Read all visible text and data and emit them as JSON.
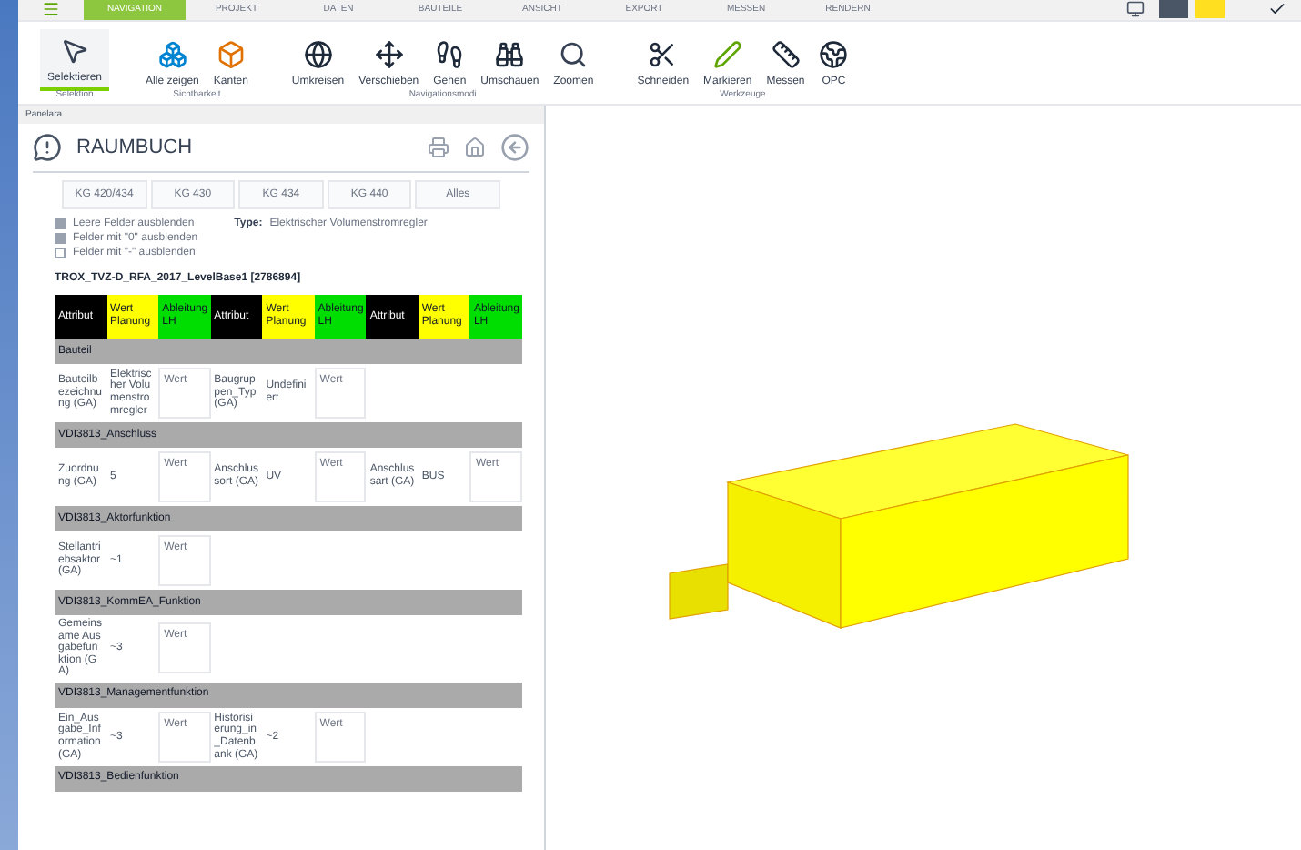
{
  "tabs": [
    {
      "label": "NAVIGATION",
      "selected": true
    },
    {
      "label": "PROJEKT",
      "selected": false
    },
    {
      "label": "DATEN",
      "selected": false
    },
    {
      "label": "BAUTEILE",
      "selected": false
    },
    {
      "label": "ANSICHT",
      "selected": false
    },
    {
      "label": "EXPORT",
      "selected": false
    },
    {
      "label": "MESSEN",
      "selected": false
    },
    {
      "label": "RENDERN",
      "selected": false
    }
  ],
  "ribbon": [
    {
      "label": "Selektion",
      "tools": [
        {
          "kind": "select",
          "label": "Selektieren",
          "selected": true
        }
      ]
    },
    {
      "label": "Sichtbarkeit",
      "tools": [
        {
          "kind": "show",
          "label": "Alle zeigen",
          "selected": false
        },
        {
          "kind": "edges",
          "label": "Kanten",
          "selected": false
        }
      ]
    },
    {
      "label": "Navigationsmodi",
      "tools": [
        {
          "kind": "orbit",
          "label": "Umkreisen",
          "selected": false
        },
        {
          "kind": "move",
          "label": "Verschieben",
          "selected": false
        },
        {
          "kind": "walk",
          "label": "Gehen",
          "selected": false
        },
        {
          "kind": "look",
          "label": "Umschauen",
          "selected": false
        },
        {
          "kind": "zoom",
          "label": "Zoomen",
          "selected": false
        }
      ]
    },
    {
      "label": "Werkzeuge",
      "tools": [
        {
          "kind": "cut",
          "label": "Schneiden",
          "selected": false
        },
        {
          "kind": "mark",
          "label": "Markieren",
          "selected": false
        },
        {
          "kind": "measure",
          "label": "Messen",
          "selected": false
        },
        {
          "kind": "opc",
          "label": "OPC",
          "selected": false
        }
      ]
    }
  ],
  "panel": {
    "caption": "Panelara",
    "title": "RAUMBUCH",
    "filter_buttons": [
      "KG 420/434",
      "KG 430",
      "KG 434",
      "KG 440",
      "Alles"
    ],
    "options": [
      {
        "label": "Leere Felder ausblenden",
        "checked": true
      },
      {
        "label": "Felder mit \"0\" ausblenden",
        "checked": true
      },
      {
        "label": "Felder mit \"-\" ausblenden",
        "checked": false
      }
    ],
    "type_label": "Type:",
    "type_value": "Elektrischer Volumenstromregler",
    "element_title": "TROX_TVZ-D_RFA_2017_LevelBase1 [2786894]",
    "columns": [
      {
        "label": "Attribut",
        "color": "#000000"
      },
      {
        "label": "Wert Planung",
        "color": "#ffff00"
      },
      {
        "label": "Ableitung LH",
        "color": "#00dd00"
      },
      {
        "label": "Attribut",
        "color": "#000000"
      },
      {
        "label": "Wert Planung",
        "color": "#ffff00"
      },
      {
        "label": "Ableitung LH",
        "color": "#00dd00"
      },
      {
        "label": "Attribut",
        "color": "#000000"
      },
      {
        "label": "Wert Planung",
        "color": "#ffff00"
      },
      {
        "label": "Ableitung LH",
        "color": "#00dd00"
      }
    ],
    "sections": [
      {
        "title": "Bauteil",
        "attributes": [
          {
            "name": "Bauteilbezeichnung (GA)",
            "value": "Elektrischer Volumenstromregler",
            "placeholder": "Wert"
          },
          {
            "name": "Baugruppen_Typ (GA)",
            "value": "Undefiniert",
            "placeholder": "Wert"
          }
        ]
      },
      {
        "title": "VDI3813_Anschluss",
        "attributes": [
          {
            "name": "Zuordnung (GA)",
            "value": "5",
            "placeholder": "Wert"
          },
          {
            "name": "Anschlussort (GA)",
            "value": "UV",
            "placeholder": "Wert"
          },
          {
            "name": "Anschlussart (GA)",
            "value": "BUS",
            "placeholder": "Wert"
          }
        ]
      },
      {
        "title": "VDI3813_Aktorfunktion",
        "attributes": [
          {
            "name": "Stellantriebsaktor (GA)",
            "value": "~1",
            "placeholder": "Wert"
          }
        ]
      },
      {
        "title": "VDI3813_KommEA_Funktion",
        "attributes": [
          {
            "name": "Gemeinsame Ausgabefunktion (GA)",
            "value": "~3",
            "placeholder": "Wert"
          }
        ]
      },
      {
        "title": "VDI3813_Managementfunktion",
        "attributes": [
          {
            "name": "Ein_Ausgabe_Information (GA)",
            "value": "~3",
            "placeholder": "Wert"
          },
          {
            "name": "Historisierung_in_Datenbank (GA)",
            "value": "~2",
            "placeholder": "Wert"
          }
        ]
      },
      {
        "title": "VDI3813_Bedienfunktion"
      }
    ]
  }
}
